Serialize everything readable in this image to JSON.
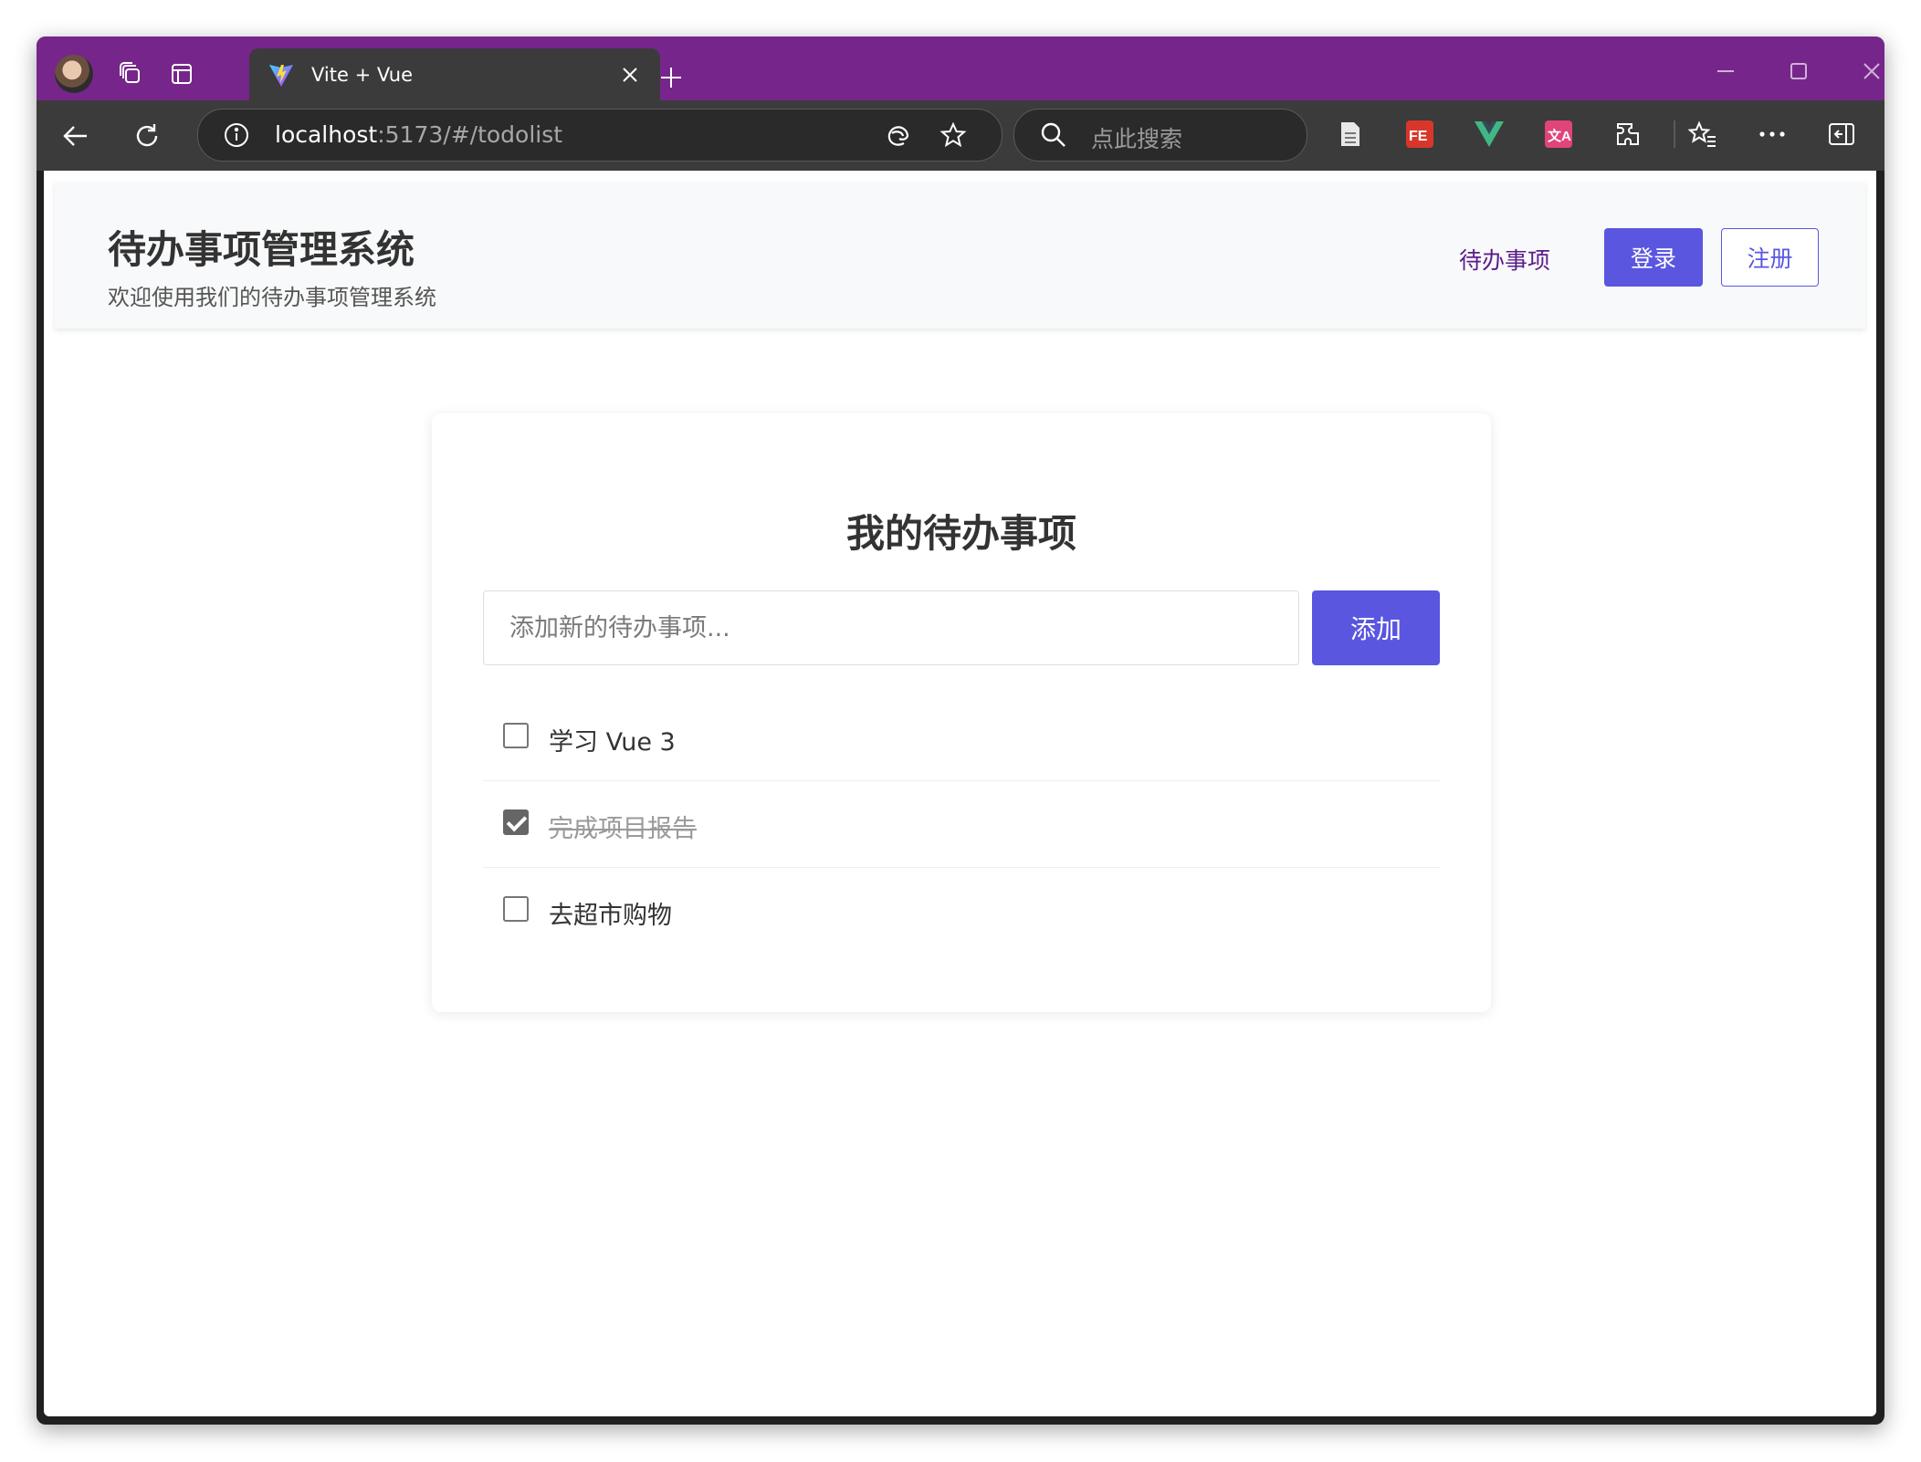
{
  "browser": {
    "tab_title": "Vite + Vue",
    "url_host": "localhost",
    "url_rest": ":5173/#/todolist",
    "search_placeholder": "点此搜索",
    "accent_color": "#76268a"
  },
  "header": {
    "title": "待办事项管理系统",
    "subtitle": "欢迎使用我们的待办事项管理系统",
    "nav_link": "待办事项",
    "login_label": "登录",
    "register_label": "注册"
  },
  "todo": {
    "title": "我的待办事项",
    "input_placeholder": "添加新的待办事项...",
    "add_label": "添加",
    "items": [
      {
        "text": "学习 Vue 3",
        "done": false
      },
      {
        "text": "完成项目报告",
        "done": true
      },
      {
        "text": "去超市购物",
        "done": false
      }
    ]
  },
  "colors": {
    "primary": "#5a56e0",
    "nav_link": "#5b1d8a"
  }
}
